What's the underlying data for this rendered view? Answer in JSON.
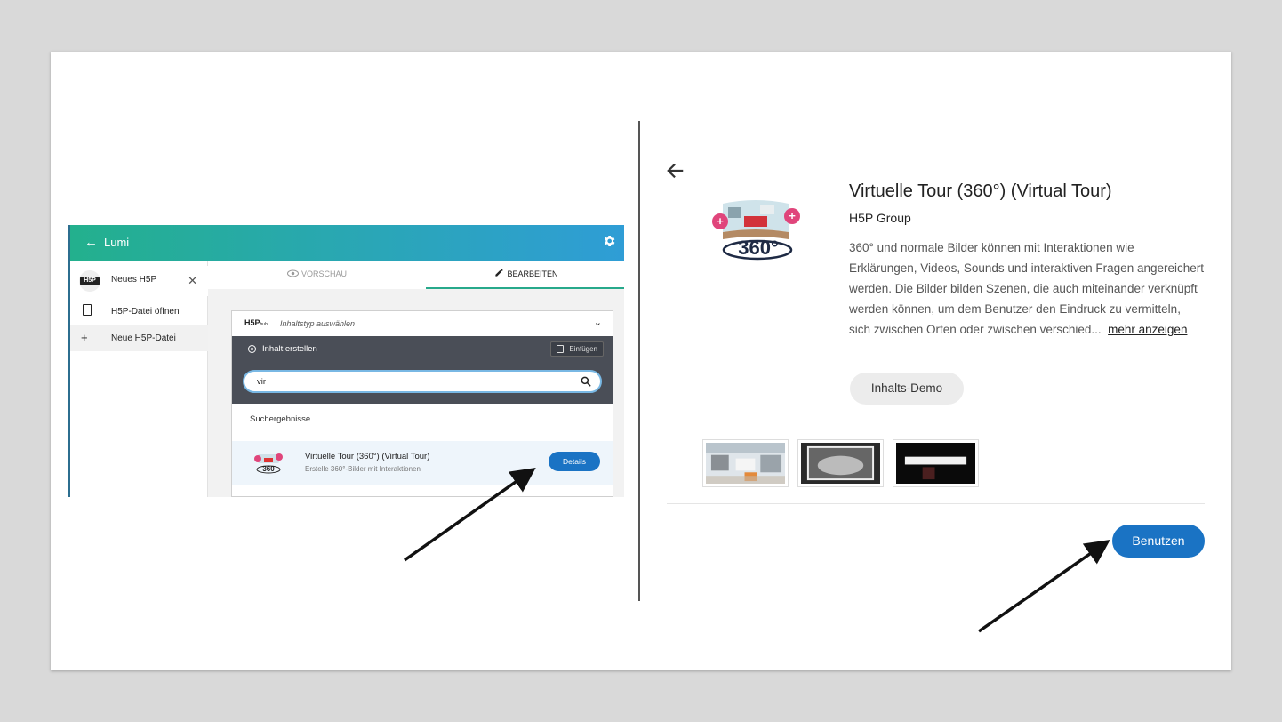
{
  "lumi": {
    "app_title": "Lumi",
    "sidebar": {
      "items": [
        {
          "label": "Neues H5P",
          "logo_text": "H5P"
        },
        {
          "label": "H5P-Datei öffnen"
        },
        {
          "label": "Neue H5P-Datei"
        }
      ]
    },
    "tabs": {
      "preview": "VORSCHAU",
      "edit": "BEARBEITEN"
    },
    "editor": {
      "hub_logo": "H5P",
      "hub_logo_suffix": "hub",
      "content_type_label": "Inhaltstyp auswählen",
      "create_label": "Inhalt erstellen",
      "insert_label": "Einfügen",
      "search_value": "vir",
      "results_heading": "Suchergebnisse",
      "result": {
        "title": "Virtuelle Tour (360°) (Virtual Tour)",
        "subtitle": "Erstelle 360°-Bilder mit Interaktionen",
        "details_label": "Details"
      }
    }
  },
  "detail": {
    "title": "Virtuelle Tour (360°) (Virtual Tour)",
    "author": "H5P Group",
    "description": "360° und normale Bilder können mit Interaktionen wie Erklärungen, Videos, Sounds und interaktiven Fragen angereichert werden. Die Bilder bilden Szenen, die auch miteinander verknüpft werden können, um dem Benutzer den Eindruck zu vermitteln, sich zwischen Orten oder zwischen verschied...",
    "more_label": "mehr anzeigen",
    "demo_label": "Inhalts-Demo",
    "use_label": "Benutzen",
    "icon_text": "360°"
  },
  "colors": {
    "header_gradient_start": "#23b08d",
    "header_gradient_end": "#2f9dd6",
    "primary_button": "#1a73c4",
    "active_tab_underline": "#27a98b",
    "editor_bar": "#4a4e57"
  },
  "icons": [
    "arrow-left-icon",
    "gear-icon",
    "close-icon",
    "document-icon",
    "plus-icon",
    "eye-icon",
    "pencil-icon",
    "chevron-down-icon",
    "radio-icon",
    "clipboard-icon",
    "search-icon",
    "vr360-icon"
  ]
}
